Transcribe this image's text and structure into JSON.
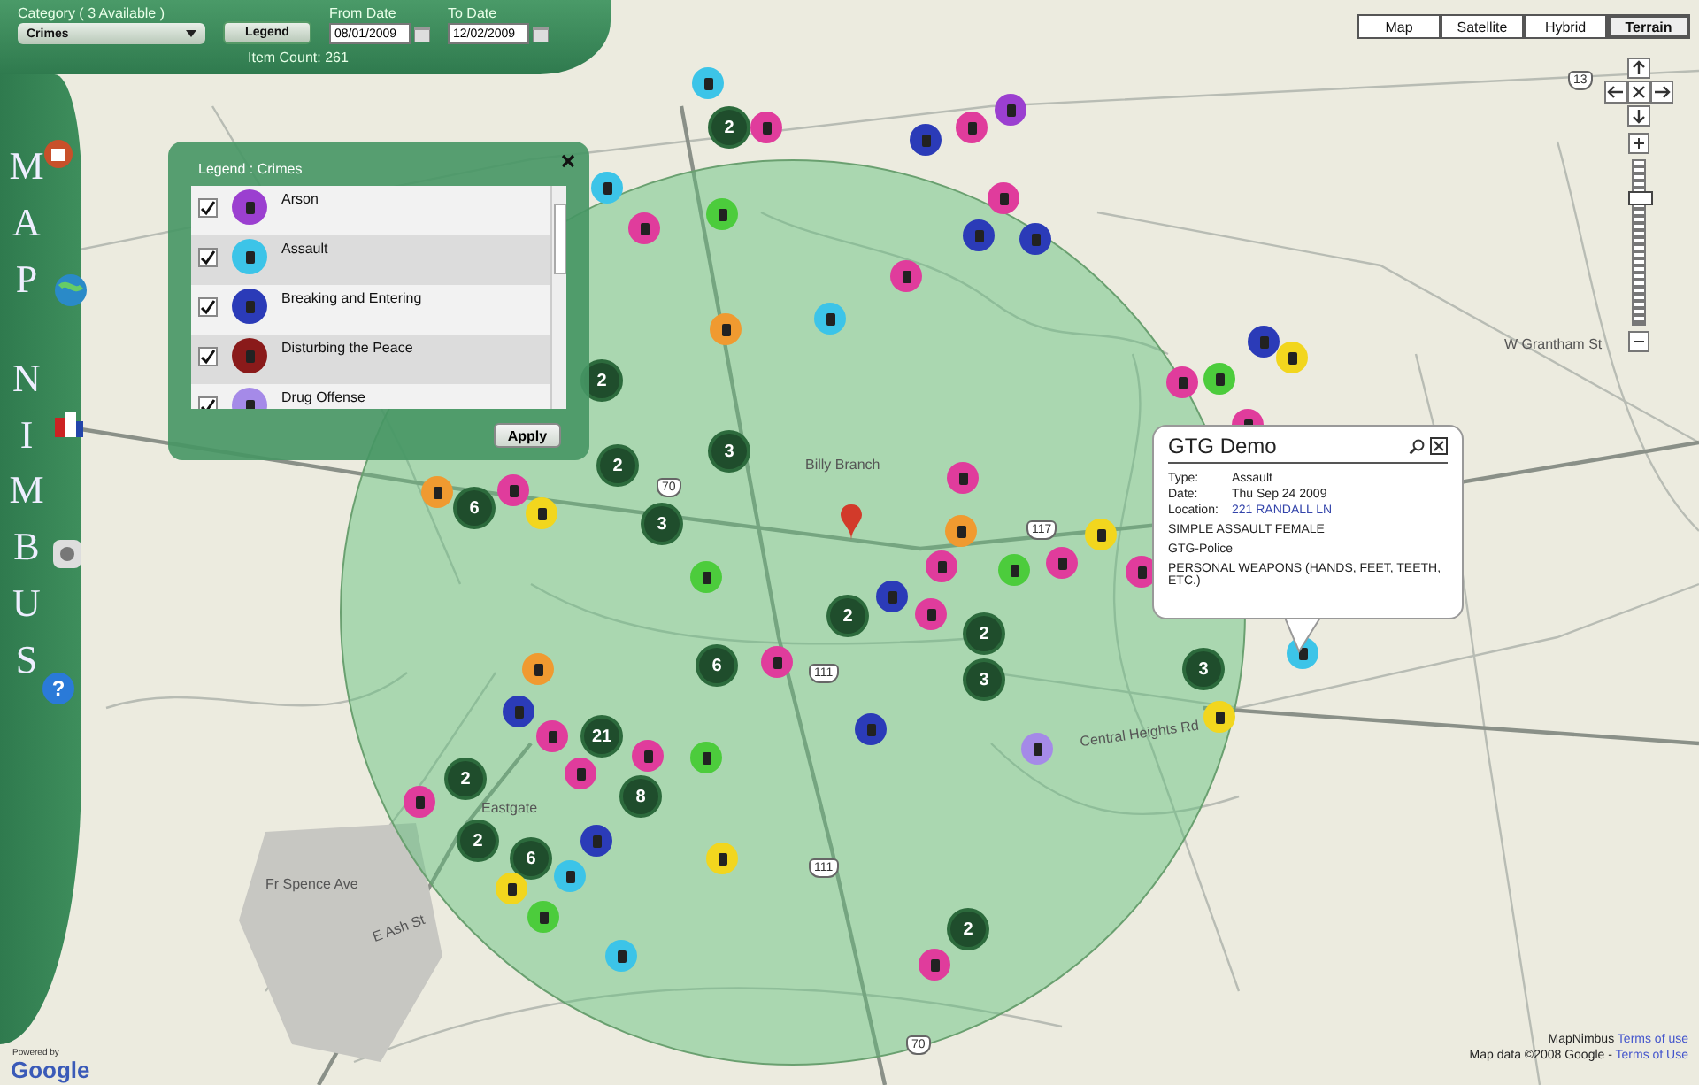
{
  "header": {
    "category_label": "Category ( 3 Available )",
    "category_value": "Crimes",
    "legend_button": "Legend",
    "from_label": "From Date",
    "from_value": "08/01/2009",
    "to_label": "To Date",
    "to_value": "12/02/2009",
    "item_count": "Item Count: 261"
  },
  "sidebar": {
    "title_lines": [
      "MAP",
      "NIMBUS"
    ],
    "help_icon": "?"
  },
  "legend": {
    "title": "Legend : Crimes",
    "apply_button": "Apply",
    "items": [
      {
        "label": "Arson",
        "checked": true,
        "color": "#9b3fd0"
      },
      {
        "label": "Assault",
        "checked": true,
        "color": "#3cc4e8"
      },
      {
        "label": "Breaking and Entering",
        "checked": true,
        "color": "#2b3bb8"
      },
      {
        "label": "Disturbing the Peace",
        "checked": true,
        "color": "#8a1a1a"
      },
      {
        "label": "Drug Offense",
        "checked": true,
        "color": "#a58ae8"
      }
    ]
  },
  "map_types": [
    {
      "label": "Map",
      "selected": false
    },
    {
      "label": "Satellite",
      "selected": false
    },
    {
      "label": "Hybrid",
      "selected": false
    },
    {
      "label": "Terrain",
      "selected": true
    }
  ],
  "zoom": {
    "level": 0.78
  },
  "street_labels": [
    "Billy Branch",
    "Central Heights Rd",
    "Eastgate",
    "E Ash St",
    "Fr Spence Ave",
    "W Grantham St"
  ],
  "route_shields": [
    "70",
    "111",
    "117",
    "70",
    "111",
    "13"
  ],
  "markers": [
    {
      "kind": "incident",
      "color": "#3cc4e8"
    },
    {
      "kind": "cluster",
      "count": "2"
    },
    {
      "kind": "incident",
      "color": "#e03c9c"
    },
    {
      "kind": "incident",
      "color": "#9b3fd0"
    },
    {
      "kind": "incident",
      "color": "#e03c9c"
    },
    {
      "kind": "incident",
      "color": "#2b3bb8"
    },
    {
      "kind": "incident",
      "color": "#3cc4e8"
    },
    {
      "kind": "incident",
      "color": "#e03c9c"
    },
    {
      "kind": "incident",
      "color": "#4ccc3c"
    },
    {
      "kind": "incident",
      "color": "#e03c9c"
    },
    {
      "kind": "incident",
      "color": "#2b3bb8"
    },
    {
      "kind": "incident",
      "color": "#2b3bb8"
    },
    {
      "kind": "incident",
      "color": "#e03c9c"
    },
    {
      "kind": "incident",
      "color": "#3cc4e8"
    },
    {
      "kind": "incident",
      "color": "#f09a30"
    },
    {
      "kind": "incident",
      "color": "#2b3bb8"
    },
    {
      "kind": "incident",
      "color": "#f2d61e"
    },
    {
      "kind": "incident",
      "color": "#e03c9c"
    },
    {
      "kind": "incident",
      "color": "#4ccc3c"
    },
    {
      "kind": "cluster",
      "count": "2"
    },
    {
      "kind": "incident",
      "color": "#e03c9c"
    },
    {
      "kind": "cluster",
      "count": "2"
    },
    {
      "kind": "cluster",
      "count": "3"
    },
    {
      "kind": "incident",
      "color": "#e03c9c"
    },
    {
      "kind": "incident",
      "color": "#f09a30"
    },
    {
      "kind": "incident",
      "color": "#e03c9c"
    },
    {
      "kind": "cluster",
      "count": "6"
    },
    {
      "kind": "incident",
      "color": "#f2d61e"
    },
    {
      "kind": "cluster",
      "count": "3"
    },
    {
      "kind": "incident",
      "color": "#f09a30"
    },
    {
      "kind": "incident",
      "color": "#f2d61e"
    },
    {
      "kind": "incident",
      "color": "#e03c9c"
    },
    {
      "kind": "incident",
      "color": "#e03c9c"
    },
    {
      "kind": "incident",
      "color": "#4ccc3c"
    },
    {
      "kind": "incident",
      "color": "#e03c9c"
    },
    {
      "kind": "incident",
      "color": "#4ccc3c"
    },
    {
      "kind": "cluster",
      "count": "2"
    },
    {
      "kind": "incident",
      "color": "#2b3bb8"
    },
    {
      "kind": "incident",
      "color": "#e03c9c"
    },
    {
      "kind": "cluster",
      "count": "2"
    },
    {
      "kind": "cluster",
      "count": "6"
    },
    {
      "kind": "incident",
      "color": "#e03c9c"
    },
    {
      "kind": "cluster",
      "count": "3"
    },
    {
      "kind": "cluster",
      "count": "3"
    },
    {
      "kind": "incident",
      "color": "#3cc4e8"
    },
    {
      "kind": "incident",
      "color": "#f09a30"
    },
    {
      "kind": "incident",
      "color": "#2b3bb8"
    },
    {
      "kind": "incident",
      "color": "#e03c9c"
    },
    {
      "kind": "incident",
      "color": "#2b3bb8"
    },
    {
      "kind": "incident",
      "color": "#f2d61e"
    },
    {
      "kind": "cluster",
      "count": "21"
    },
    {
      "kind": "incident",
      "color": "#4ccc3c"
    },
    {
      "kind": "incident",
      "color": "#a58ae8"
    },
    {
      "kind": "cluster",
      "count": "8"
    },
    {
      "kind": "incident",
      "color": "#e03c9c"
    },
    {
      "kind": "cluster",
      "count": "2"
    },
    {
      "kind": "cluster",
      "count": "2"
    },
    {
      "kind": "incident",
      "color": "#2b3bb8"
    },
    {
      "kind": "cluster",
      "count": "6"
    },
    {
      "kind": "incident",
      "color": "#f2d61e"
    },
    {
      "kind": "incident",
      "color": "#f2d61e"
    },
    {
      "kind": "incident",
      "color": "#3cc4e8"
    },
    {
      "kind": "incident",
      "color": "#3cc4e8"
    },
    {
      "kind": "cluster",
      "count": "2"
    },
    {
      "kind": "incident",
      "color": "#e03c9c"
    },
    {
      "kind": "incident",
      "color": "#4ccc3c"
    },
    {
      "kind": "incident",
      "color": "#e03c9c"
    },
    {
      "kind": "incident",
      "color": "#e03c9c"
    }
  ],
  "popup": {
    "title": "GTG Demo",
    "fields": [
      {
        "label": "Type:",
        "value": "Assault",
        "kind": "text"
      },
      {
        "label": "Date:",
        "value": "Thu Sep 24 2009",
        "kind": "text"
      },
      {
        "label": "Location:",
        "value": "221  RANDALL LN",
        "kind": "link"
      }
    ],
    "lines": [
      "SIMPLE ASSAULT FEMALE",
      "GTG-Police",
      "PERSONAL WEAPONS (HANDS, FEET, TEETH, ETC.)"
    ]
  },
  "footer": {
    "google_powered": "Powered by",
    "google_logo": "Google",
    "credit": "MapNimbus",
    "credit_link": "Terms of use",
    "map_data": "Map data ©2008  Google - ",
    "map_data_link": "Terms of Use"
  }
}
